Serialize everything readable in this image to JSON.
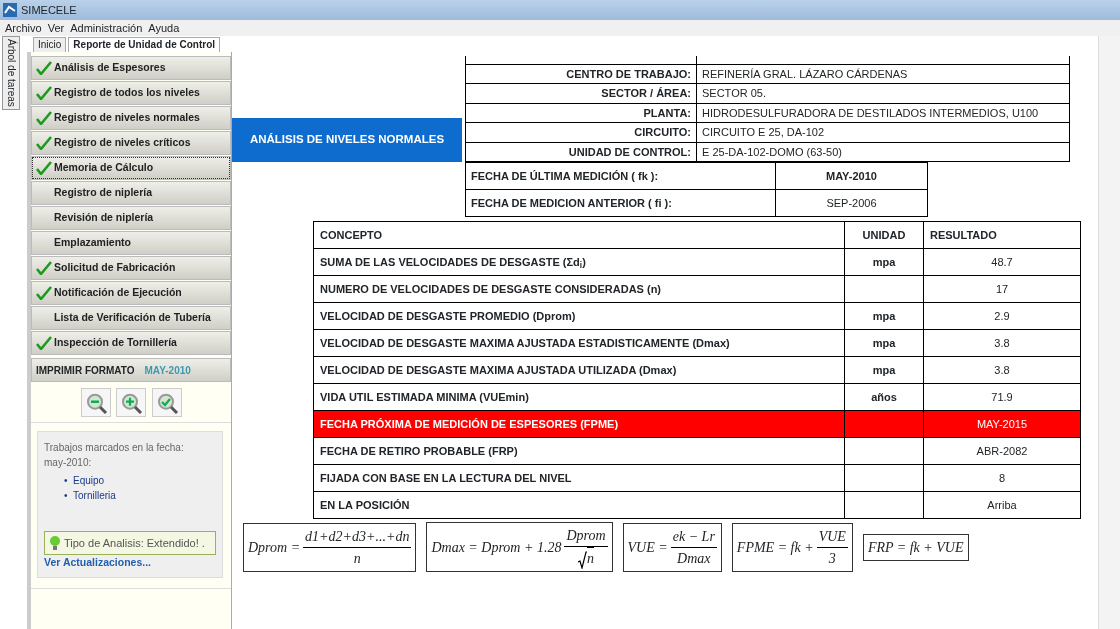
{
  "window": {
    "title": "SIMECELE"
  },
  "menu": [
    "Archivo",
    "Ver",
    "Administración",
    "Ayuda"
  ],
  "side_tab": "Árbol de tareas",
  "tabs": [
    {
      "label": "Inicio",
      "selected": false
    },
    {
      "label": "Reporte de Unidad de Control",
      "selected": true
    }
  ],
  "sidebar": {
    "items": [
      {
        "label": "Análisis de Espesores",
        "checked": true,
        "selected": false
      },
      {
        "label": "Registro de todos los niveles",
        "checked": true,
        "selected": false
      },
      {
        "label": "Registro de niveles normales",
        "checked": true,
        "selected": false
      },
      {
        "label": "Registro de niveles críticos",
        "checked": true,
        "selected": false
      },
      {
        "label": "Memoria de Cálculo",
        "checked": true,
        "selected": true
      },
      {
        "label": "Registro de niplería",
        "checked": false,
        "selected": false
      },
      {
        "label": "Revisión de niplería",
        "checked": false,
        "selected": false
      },
      {
        "label": "Emplazamiento",
        "checked": false,
        "selected": false
      },
      {
        "label": "Solicitud de Fabricación",
        "checked": true,
        "selected": false
      },
      {
        "label": "Notificación de Ejecución",
        "checked": true,
        "selected": false
      },
      {
        "label": "Lista de Verificación de Tubería",
        "checked": false,
        "selected": false
      },
      {
        "label": "Inspección de Tornillería",
        "checked": true,
        "selected": false
      }
    ],
    "print": {
      "label": "IMPRIMIR FORMATO",
      "date": "MAY-2010",
      "buttons": [
        {
          "kind": "minus"
        },
        {
          "kind": "plus"
        },
        {
          "kind": "check"
        }
      ]
    },
    "notes": {
      "text": "Trabajos marcados en la fecha: may-2010:",
      "bullet": "•",
      "items": [
        "Equipo",
        "Tornilleria"
      ],
      "tip": "Tipo de Analisis: Extendido! .",
      "link": "Ver Actualizaciones..."
    }
  },
  "report": {
    "title": "ANÁLISIS DE NIVELES NORMALES",
    "info": [
      {
        "label": "CENTRO DE TRABAJO:",
        "value": "REFINERÍA GRAL. LÁZARO CÁRDENAS"
      },
      {
        "label": "SECTOR / ÁREA:",
        "value": "SECTOR 05."
      },
      {
        "label": "PLANTA:",
        "value": "HIDRODESULFURADORA DE DESTILADOS INTERMEDIOS, U100"
      },
      {
        "label": "CIRCUITO:",
        "value": "CIRCUITO E 25, DA-102"
      },
      {
        "label": "UNIDAD DE CONTROL:",
        "value": "E 25-DA-102-DOMO (63-50)"
      }
    ],
    "dates": [
      {
        "label": "FECHA DE ÚLTIMA MEDICIÓN ( fk ):",
        "value": "MAY-2010"
      },
      {
        "label": "FECHA DE MEDICION ANTERIOR ( fi ):",
        "value": "SEP-2006"
      }
    ],
    "table": {
      "columns": [
        "CONCEPTO",
        "UNIDAD",
        "RESULTADO"
      ],
      "rows": [
        {
          "concept": "SUMA DE LAS VELOCIDADES DE DESGASTE (Σd$_{i}$)",
          "unit": "mpa",
          "result": "48.7",
          "highlight": false
        },
        {
          "concept": "NUMERO DE VELOCIDADES DE DESGASTE CONSIDERADAS (n)",
          "result": "17",
          "highlight": false
        },
        {
          "concept": "VELOCIDAD DE DESGASTE PROMEDIO (Dprom)",
          "unit": "mpa",
          "result": "2.9",
          "highlight": false
        },
        {
          "concept": "VELOCIDAD DE DESGASTE MAXIMA AJUSTADA ESTADISTICAMENTE (Dmax)",
          "unit": "mpa",
          "result": "3.8",
          "highlight": false
        },
        {
          "concept": "VELOCIDAD DE DESGASTE MAXIMA AJUSTADA UTILIZADA (Dmax)",
          "unit": "mpa",
          "result": "3.8",
          "highlight": false
        },
        {
          "concept": "VIDA UTIL ESTIMADA MINIMA (VUEmin)",
          "unit": "años",
          "result": "71.9",
          "highlight": false
        },
        {
          "concept": "FECHA PRÓXIMA DE MEDICIÓN DE ESPESORES (FPME)",
          "result": "MAY-2015",
          "highlight": true
        },
        {
          "concept": "FECHA DE RETIRO PROBABLE (FRP)",
          "result": "ABR-2082",
          "highlight": false
        },
        {
          "concept": "FIJADA CON BASE EN LA LECTURA DEL NIVEL",
          "result": "8",
          "highlight": false
        },
        {
          "concept": "EN LA POSICIÓN",
          "result": "Arriba",
          "highlight": false
        }
      ]
    },
    "formulas": [
      [
        {
          "kind": "text",
          "text": "Dprom ="
        },
        {
          "kind": "frac",
          "num": "d1+d2+d3+...+dn",
          "den": "n",
          "root": false
        }
      ],
      [
        {
          "kind": "text",
          "text": "Dmax = Dprom + 1.28"
        },
        {
          "kind": "frac",
          "num": "Dprom",
          "den": "n",
          "root": true
        }
      ],
      [
        {
          "kind": "text",
          "text": "VUE ="
        },
        {
          "kind": "frac",
          "num": "ek − Lr",
          "den": "Dmax",
          "root": false
        }
      ],
      [
        {
          "kind": "text",
          "text": "FPME = fk +"
        },
        {
          "kind": "frac",
          "num": "VUE",
          "den": "3",
          "root": false
        }
      ],
      [
        {
          "kind": "text",
          "text": "FRP = fk + VUE"
        }
      ]
    ]
  }
}
